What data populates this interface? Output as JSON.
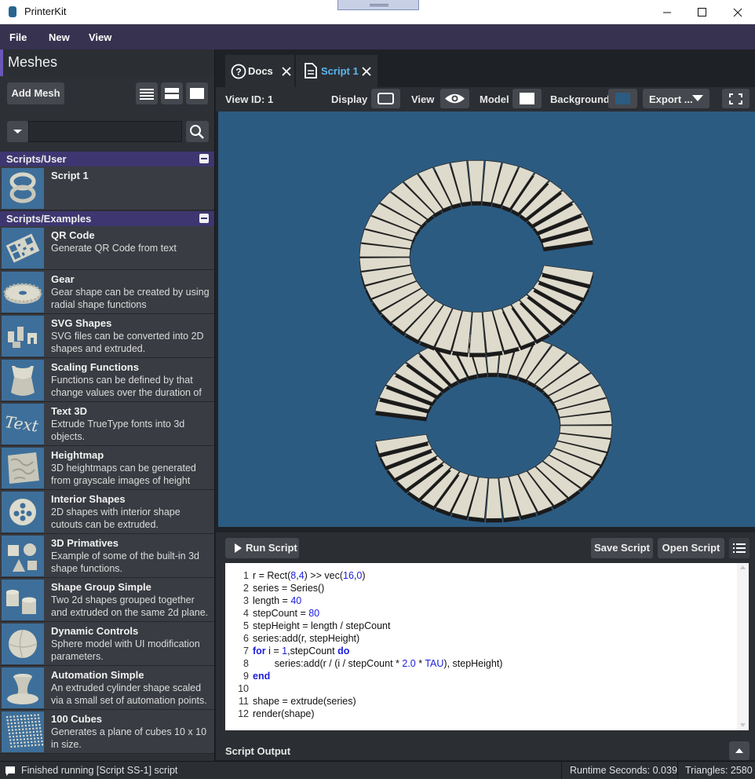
{
  "window": {
    "title": "PrinterKit",
    "controls": [
      "minimize",
      "maximize",
      "close"
    ]
  },
  "menu": [
    "File",
    "New",
    "View"
  ],
  "sidebar": {
    "title": "Meshes",
    "add_mesh_label": "Add Mesh",
    "search_placeholder": "",
    "sections": [
      {
        "title": "Scripts/User",
        "items": [
          {
            "name": "Script 1",
            "description": "",
            "thumb": "spiral-stair"
          }
        ]
      },
      {
        "title": "Scripts/Examples",
        "items": [
          {
            "name": "QR Code",
            "description": "Generate QR Code from text",
            "thumb": "qr"
          },
          {
            "name": "Gear",
            "description": "Gear shape can be created by using radial shape functions",
            "thumb": "gear"
          },
          {
            "name": "SVG Shapes",
            "description": "SVG files can be converted into 2D shapes and extruded.",
            "thumb": "svg"
          },
          {
            "name": "Scaling Functions",
            "description": "Functions can be defined by that change values over the duration of",
            "thumb": "scaling"
          },
          {
            "name": "Text 3D",
            "description": "Extrude TrueType fonts into 3d objects.",
            "thumb": "text"
          },
          {
            "name": "Heightmap",
            "description": "3D heightmaps can be generated from grayscale images of height",
            "thumb": "heightmap"
          },
          {
            "name": "Interior Shapes",
            "description": "2D shapes with interior shape cutouts can be extruded.",
            "thumb": "interior"
          },
          {
            "name": "3D Primatives",
            "description": "Example of some of the built-in 3d shape functions.",
            "thumb": "primitives"
          },
          {
            "name": "Shape Group Simple",
            "description": "Two 2d shapes grouped together and extruded on the same 2d plane.",
            "thumb": "group"
          },
          {
            "name": "Dynamic Controls",
            "description": "Sphere model with UI modification parameters.",
            "thumb": "sphere"
          },
          {
            "name": "Automation Simple",
            "description": "An extruded cylinder shape scaled via a small set of automation points.",
            "thumb": "automation"
          },
          {
            "name": "100 Cubes",
            "description": "Generates a plane of cubes 10 x 10 in size.",
            "thumb": "cubes"
          }
        ]
      }
    ]
  },
  "tabs": [
    {
      "label": "Docs",
      "icon": "help-icon",
      "active": false
    },
    {
      "label": "Script 1",
      "icon": "document-icon",
      "active": true
    }
  ],
  "toolbar": {
    "view_id": "View ID: 1",
    "display_label": "Display",
    "view_label": "View",
    "model_label": "Model",
    "background_label": "Background",
    "background_color": "#2c5b81",
    "export_label": "Export ..."
  },
  "script_panel": {
    "run_label": "Run Script",
    "save_label": "Save Script",
    "open_label": "Open Script",
    "output_label": "Script Output",
    "code_lines": [
      "r = Rect(8,4) >> vec(16,0)",
      "series = Series()",
      "length = 40",
      "stepCount = 80",
      "stepHeight = length / stepCount",
      "series:add(r, stepHeight)",
      "for i = 1,stepCount do",
      "        series:add(r / (i / stepCount * 2.0 * TAU), stepHeight)",
      "end",
      "",
      "shape = extrude(series)",
      "render(shape)"
    ]
  },
  "status": {
    "message": "Finished running [Script SS-1] script",
    "runtime": "Runtime Seconds: 0.039",
    "triangles": "Triangles: 2580"
  },
  "colors": {
    "accent": "#6a56b8",
    "menu_bg": "#37324f",
    "section_bg": "#3e3670",
    "active_tab": "#5ab7f0",
    "model": "#dedbcc"
  }
}
